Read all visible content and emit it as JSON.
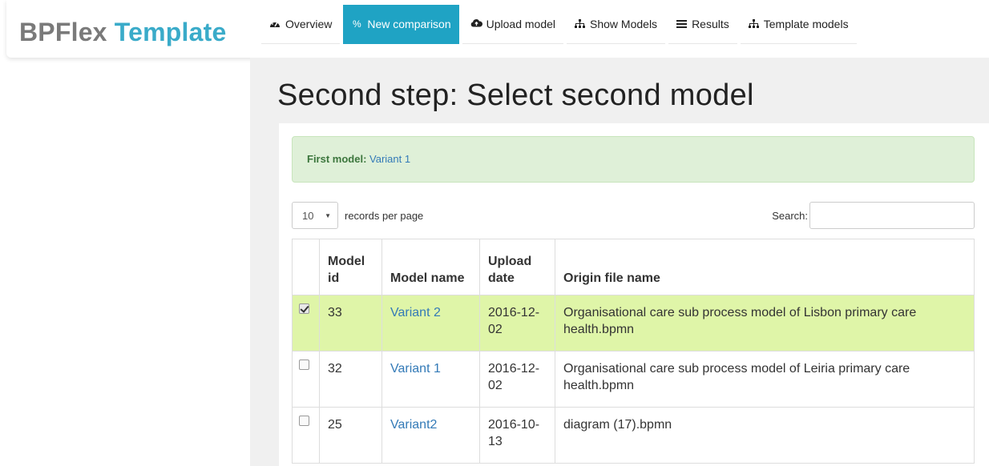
{
  "brand": {
    "part1": "BPFlex",
    "part2": "Template"
  },
  "nav": {
    "items": [
      {
        "label": "Overview",
        "icon": "dashboard-icon"
      },
      {
        "label": "New comparison",
        "icon": "percent-icon",
        "active": true
      },
      {
        "label": "Upload model",
        "icon": "cloud-upload-icon"
      },
      {
        "label": "Show Models",
        "icon": "sitemap-icon"
      },
      {
        "label": "Results",
        "icon": "list-icon"
      },
      {
        "label": "Template models",
        "icon": "sitemap-icon"
      }
    ]
  },
  "page": {
    "title": "Second step: Select second model"
  },
  "alert": {
    "label": "First model:",
    "value": "Variant 1"
  },
  "table_controls": {
    "page_length": "10",
    "page_length_suffix": "records per page",
    "search_label": "Search:",
    "search_value": ""
  },
  "table": {
    "headers": [
      "",
      "Model id",
      "Model name",
      "Upload date",
      "Origin file name"
    ],
    "rows": [
      {
        "checked": true,
        "id": "33",
        "name": "Variant 2",
        "date": "2016-12-02",
        "file": "Organisational care sub process model of Lisbon primary care health.bpmn"
      },
      {
        "checked": false,
        "id": "32",
        "name": "Variant 1",
        "date": "2016-12-02",
        "file": "Organisational care sub process model of Leiria primary care health.bpmn"
      },
      {
        "checked": false,
        "id": "25",
        "name": "Variant2",
        "date": "2016-10-13",
        "file": "diagram (17).bpmn"
      }
    ]
  },
  "colors": {
    "brand_accent": "#3aabc9",
    "nav_active": "#1fa3c4",
    "alert_bg": "#dff0d8",
    "selected_row": "#dff5a8",
    "link": "#337ab7"
  }
}
